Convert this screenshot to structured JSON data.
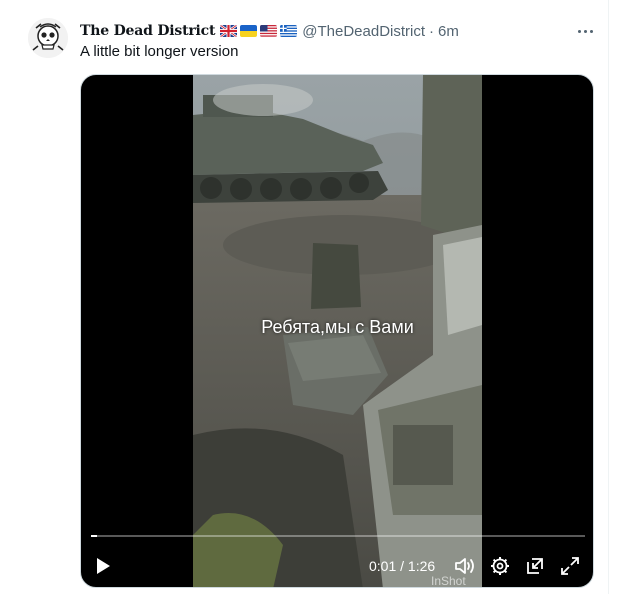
{
  "tweet": {
    "display_name": "The Dead District",
    "flags": [
      "uk-flag",
      "ukraine-flag",
      "us-flag",
      "greece-flag"
    ],
    "handle": "@TheDeadDistrict",
    "separator": "·",
    "time": "6m",
    "text": "A little bit longer version"
  },
  "video": {
    "caption": "Ребята,мы с Вами",
    "timecode": "0:01 / 1:26",
    "progress": 0.012,
    "watermark": "InShot",
    "controls": [
      "play-icon",
      "volume-icon",
      "settings-icon",
      "popout-icon",
      "fullscreen-icon"
    ]
  },
  "colors": {
    "secondary_text": "#536471",
    "primary_text": "#0f1419",
    "video_bg": "#000000"
  }
}
